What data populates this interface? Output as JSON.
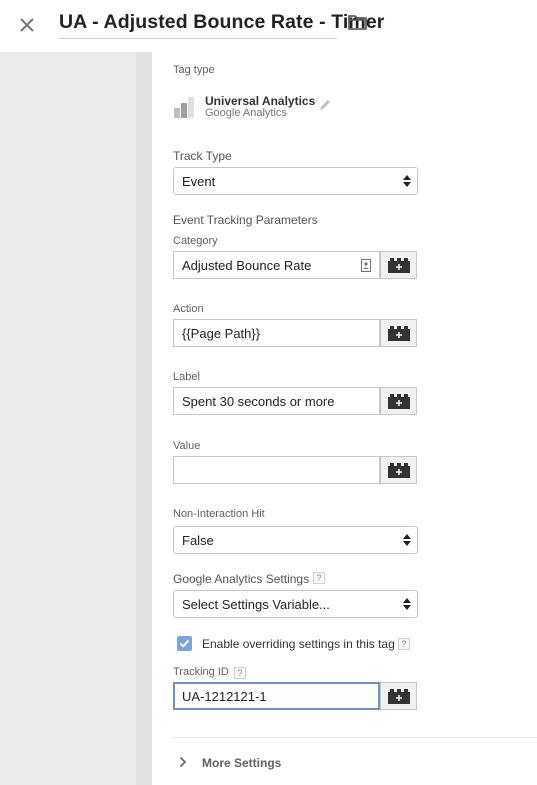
{
  "header": {
    "title": "UA - Adjusted Bounce Rate - Timer",
    "close_icon": "close-icon",
    "folder_icon": "folder-icon"
  },
  "tag_type": {
    "label": "Tag type",
    "name": "Universal Analytics",
    "provider": "Google Analytics"
  },
  "track_type": {
    "label": "Track Type",
    "value": "Event"
  },
  "event_params": {
    "heading": "Event Tracking Parameters",
    "category": {
      "label": "Category",
      "value": "Adjusted Bounce Rate"
    },
    "action": {
      "label": "Action",
      "value": "{{Page Path}}"
    },
    "label": {
      "label": "Label",
      "value": "Spent 30 seconds or more"
    },
    "value": {
      "label": "Value",
      "value": ""
    }
  },
  "non_interaction": {
    "label": "Non-Interaction Hit",
    "value": "False"
  },
  "ga_settings": {
    "label": "Google Analytics Settings",
    "help": "?",
    "value": "Select Settings Variable..."
  },
  "override": {
    "checked": true,
    "label": "Enable overriding settings in this tag",
    "help": "?"
  },
  "tracking_id": {
    "label": "Tracking ID",
    "help": "?",
    "value": "UA-1212121-1"
  },
  "more_settings": {
    "label": "More Settings"
  },
  "colors": {
    "accent": "#7aa3e0",
    "focus_border": "#6a93c9",
    "background": "#ebebeb"
  }
}
